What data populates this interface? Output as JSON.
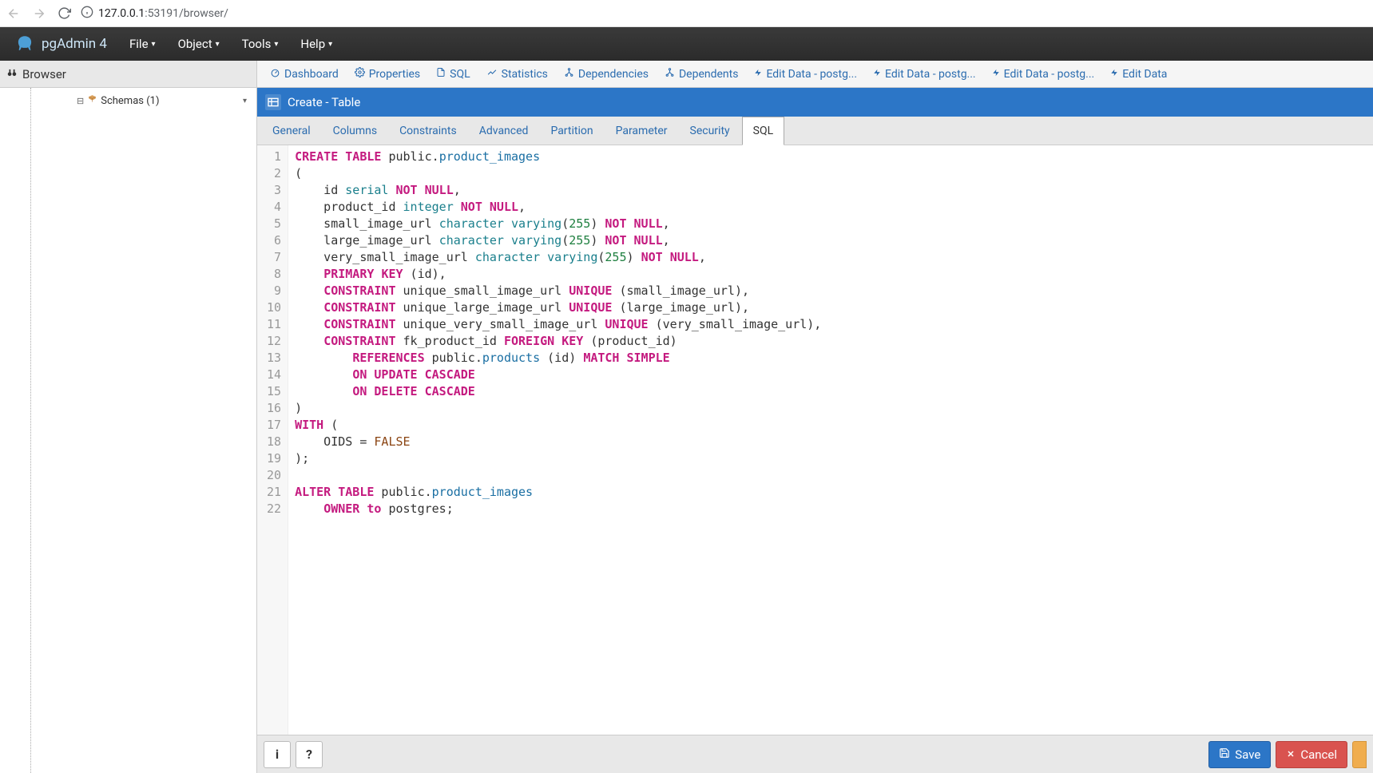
{
  "chrome": {
    "url_host": "127.0.0.1",
    "url_port": ":53191",
    "url_path": "/browser/"
  },
  "menubar": {
    "brand": "pgAdmin 4",
    "items": [
      "File",
      "Object",
      "Tools",
      "Help"
    ]
  },
  "sidebar": {
    "title": "Browser",
    "tree_node": "Schemas (1)"
  },
  "tabstrip": {
    "tabs": [
      {
        "icon": "dashboard",
        "label": "Dashboard"
      },
      {
        "icon": "cogs",
        "label": "Properties"
      },
      {
        "icon": "file",
        "label": "SQL"
      },
      {
        "icon": "chart",
        "label": "Statistics"
      },
      {
        "icon": "link",
        "label": "Dependencies"
      },
      {
        "icon": "link",
        "label": "Dependents"
      },
      {
        "icon": "bolt",
        "label": "Edit Data - postg..."
      },
      {
        "icon": "bolt",
        "label": "Edit Data - postg..."
      },
      {
        "icon": "bolt",
        "label": "Edit Data - postg..."
      },
      {
        "icon": "bolt",
        "label": "Edit Data"
      }
    ]
  },
  "dialog": {
    "title": "Create - Table",
    "tabs": [
      "General",
      "Columns",
      "Constraints",
      "Advanced",
      "Partition",
      "Parameter",
      "Security",
      "SQL"
    ],
    "active_tab": "SQL",
    "footer": {
      "save": "Save",
      "cancel": "Cancel"
    }
  },
  "sql": {
    "lines": [
      [
        {
          "t": "kw",
          "v": "CREATE"
        },
        {
          "t": "sp"
        },
        {
          "t": "kw",
          "v": "TABLE"
        },
        {
          "t": "sp"
        },
        {
          "t": "plain",
          "v": "public."
        },
        {
          "t": "ident",
          "v": "product_images"
        }
      ],
      [
        {
          "t": "plain",
          "v": "("
        }
      ],
      [
        {
          "t": "plain",
          "v": "    id "
        },
        {
          "t": "type",
          "v": "serial"
        },
        {
          "t": "sp"
        },
        {
          "t": "kw",
          "v": "NOT"
        },
        {
          "t": "sp"
        },
        {
          "t": "kw",
          "v": "NULL"
        },
        {
          "t": "plain",
          "v": ","
        }
      ],
      [
        {
          "t": "plain",
          "v": "    product_id "
        },
        {
          "t": "type",
          "v": "integer"
        },
        {
          "t": "sp"
        },
        {
          "t": "kw",
          "v": "NOT"
        },
        {
          "t": "sp"
        },
        {
          "t": "kw",
          "v": "NULL"
        },
        {
          "t": "plain",
          "v": ","
        }
      ],
      [
        {
          "t": "plain",
          "v": "    small_image_url "
        },
        {
          "t": "type",
          "v": "character"
        },
        {
          "t": "sp"
        },
        {
          "t": "type",
          "v": "varying"
        },
        {
          "t": "plain",
          "v": "("
        },
        {
          "t": "num",
          "v": "255"
        },
        {
          "t": "plain",
          "v": ") "
        },
        {
          "t": "kw",
          "v": "NOT"
        },
        {
          "t": "sp"
        },
        {
          "t": "kw",
          "v": "NULL"
        },
        {
          "t": "plain",
          "v": ","
        }
      ],
      [
        {
          "t": "plain",
          "v": "    large_image_url "
        },
        {
          "t": "type",
          "v": "character"
        },
        {
          "t": "sp"
        },
        {
          "t": "type",
          "v": "varying"
        },
        {
          "t": "plain",
          "v": "("
        },
        {
          "t": "num",
          "v": "255"
        },
        {
          "t": "plain",
          "v": ") "
        },
        {
          "t": "kw",
          "v": "NOT"
        },
        {
          "t": "sp"
        },
        {
          "t": "kw",
          "v": "NULL"
        },
        {
          "t": "plain",
          "v": ","
        }
      ],
      [
        {
          "t": "plain",
          "v": "    very_small_image_url "
        },
        {
          "t": "type",
          "v": "character"
        },
        {
          "t": "sp"
        },
        {
          "t": "type",
          "v": "varying"
        },
        {
          "t": "plain",
          "v": "("
        },
        {
          "t": "num",
          "v": "255"
        },
        {
          "t": "plain",
          "v": ") "
        },
        {
          "t": "kw",
          "v": "NOT"
        },
        {
          "t": "sp"
        },
        {
          "t": "kw",
          "v": "NULL"
        },
        {
          "t": "plain",
          "v": ","
        }
      ],
      [
        {
          "t": "plain",
          "v": "    "
        },
        {
          "t": "kw",
          "v": "PRIMARY"
        },
        {
          "t": "sp"
        },
        {
          "t": "kw",
          "v": "KEY"
        },
        {
          "t": "plain",
          "v": " (id),"
        }
      ],
      [
        {
          "t": "plain",
          "v": "    "
        },
        {
          "t": "kw",
          "v": "CONSTRAINT"
        },
        {
          "t": "plain",
          "v": " unique_small_image_url "
        },
        {
          "t": "kw",
          "v": "UNIQUE"
        },
        {
          "t": "plain",
          "v": " (small_image_url),"
        }
      ],
      [
        {
          "t": "plain",
          "v": "    "
        },
        {
          "t": "kw",
          "v": "CONSTRAINT"
        },
        {
          "t": "plain",
          "v": " unique_large_image_url "
        },
        {
          "t": "kw",
          "v": "UNIQUE"
        },
        {
          "t": "plain",
          "v": " (large_image_url),"
        }
      ],
      [
        {
          "t": "plain",
          "v": "    "
        },
        {
          "t": "kw",
          "v": "CONSTRAINT"
        },
        {
          "t": "plain",
          "v": " unique_very_small_image_url "
        },
        {
          "t": "kw",
          "v": "UNIQUE"
        },
        {
          "t": "plain",
          "v": " (very_small_image_url),"
        }
      ],
      [
        {
          "t": "plain",
          "v": "    "
        },
        {
          "t": "kw",
          "v": "CONSTRAINT"
        },
        {
          "t": "plain",
          "v": " fk_product_id "
        },
        {
          "t": "kw",
          "v": "FOREIGN"
        },
        {
          "t": "sp"
        },
        {
          "t": "kw",
          "v": "KEY"
        },
        {
          "t": "plain",
          "v": " (product_id)"
        }
      ],
      [
        {
          "t": "plain",
          "v": "        "
        },
        {
          "t": "kw",
          "v": "REFERENCES"
        },
        {
          "t": "plain",
          "v": " public."
        },
        {
          "t": "ident",
          "v": "products"
        },
        {
          "t": "plain",
          "v": " (id) "
        },
        {
          "t": "kw",
          "v": "MATCH"
        },
        {
          "t": "sp"
        },
        {
          "t": "kw",
          "v": "SIMPLE"
        }
      ],
      [
        {
          "t": "plain",
          "v": "        "
        },
        {
          "t": "kw",
          "v": "ON"
        },
        {
          "t": "sp"
        },
        {
          "t": "kw",
          "v": "UPDATE"
        },
        {
          "t": "sp"
        },
        {
          "t": "kw",
          "v": "CASCADE"
        }
      ],
      [
        {
          "t": "plain",
          "v": "        "
        },
        {
          "t": "kw",
          "v": "ON"
        },
        {
          "t": "sp"
        },
        {
          "t": "kw",
          "v": "DELETE"
        },
        {
          "t": "sp"
        },
        {
          "t": "kw",
          "v": "CASCADE"
        }
      ],
      [
        {
          "t": "plain",
          "v": ")"
        }
      ],
      [
        {
          "t": "kw",
          "v": "WITH"
        },
        {
          "t": "plain",
          "v": " ("
        }
      ],
      [
        {
          "t": "plain",
          "v": "    OIDS = "
        },
        {
          "t": "bool",
          "v": "FALSE"
        }
      ],
      [
        {
          "t": "plain",
          "v": ");"
        }
      ],
      [],
      [
        {
          "t": "kw",
          "v": "ALTER"
        },
        {
          "t": "sp"
        },
        {
          "t": "kw",
          "v": "TABLE"
        },
        {
          "t": "plain",
          "v": " public."
        },
        {
          "t": "ident",
          "v": "product_images"
        }
      ],
      [
        {
          "t": "plain",
          "v": "    "
        },
        {
          "t": "kw",
          "v": "OWNER"
        },
        {
          "t": "sp"
        },
        {
          "t": "kw",
          "v": "to"
        },
        {
          "t": "plain",
          "v": " postgres;"
        }
      ]
    ]
  }
}
